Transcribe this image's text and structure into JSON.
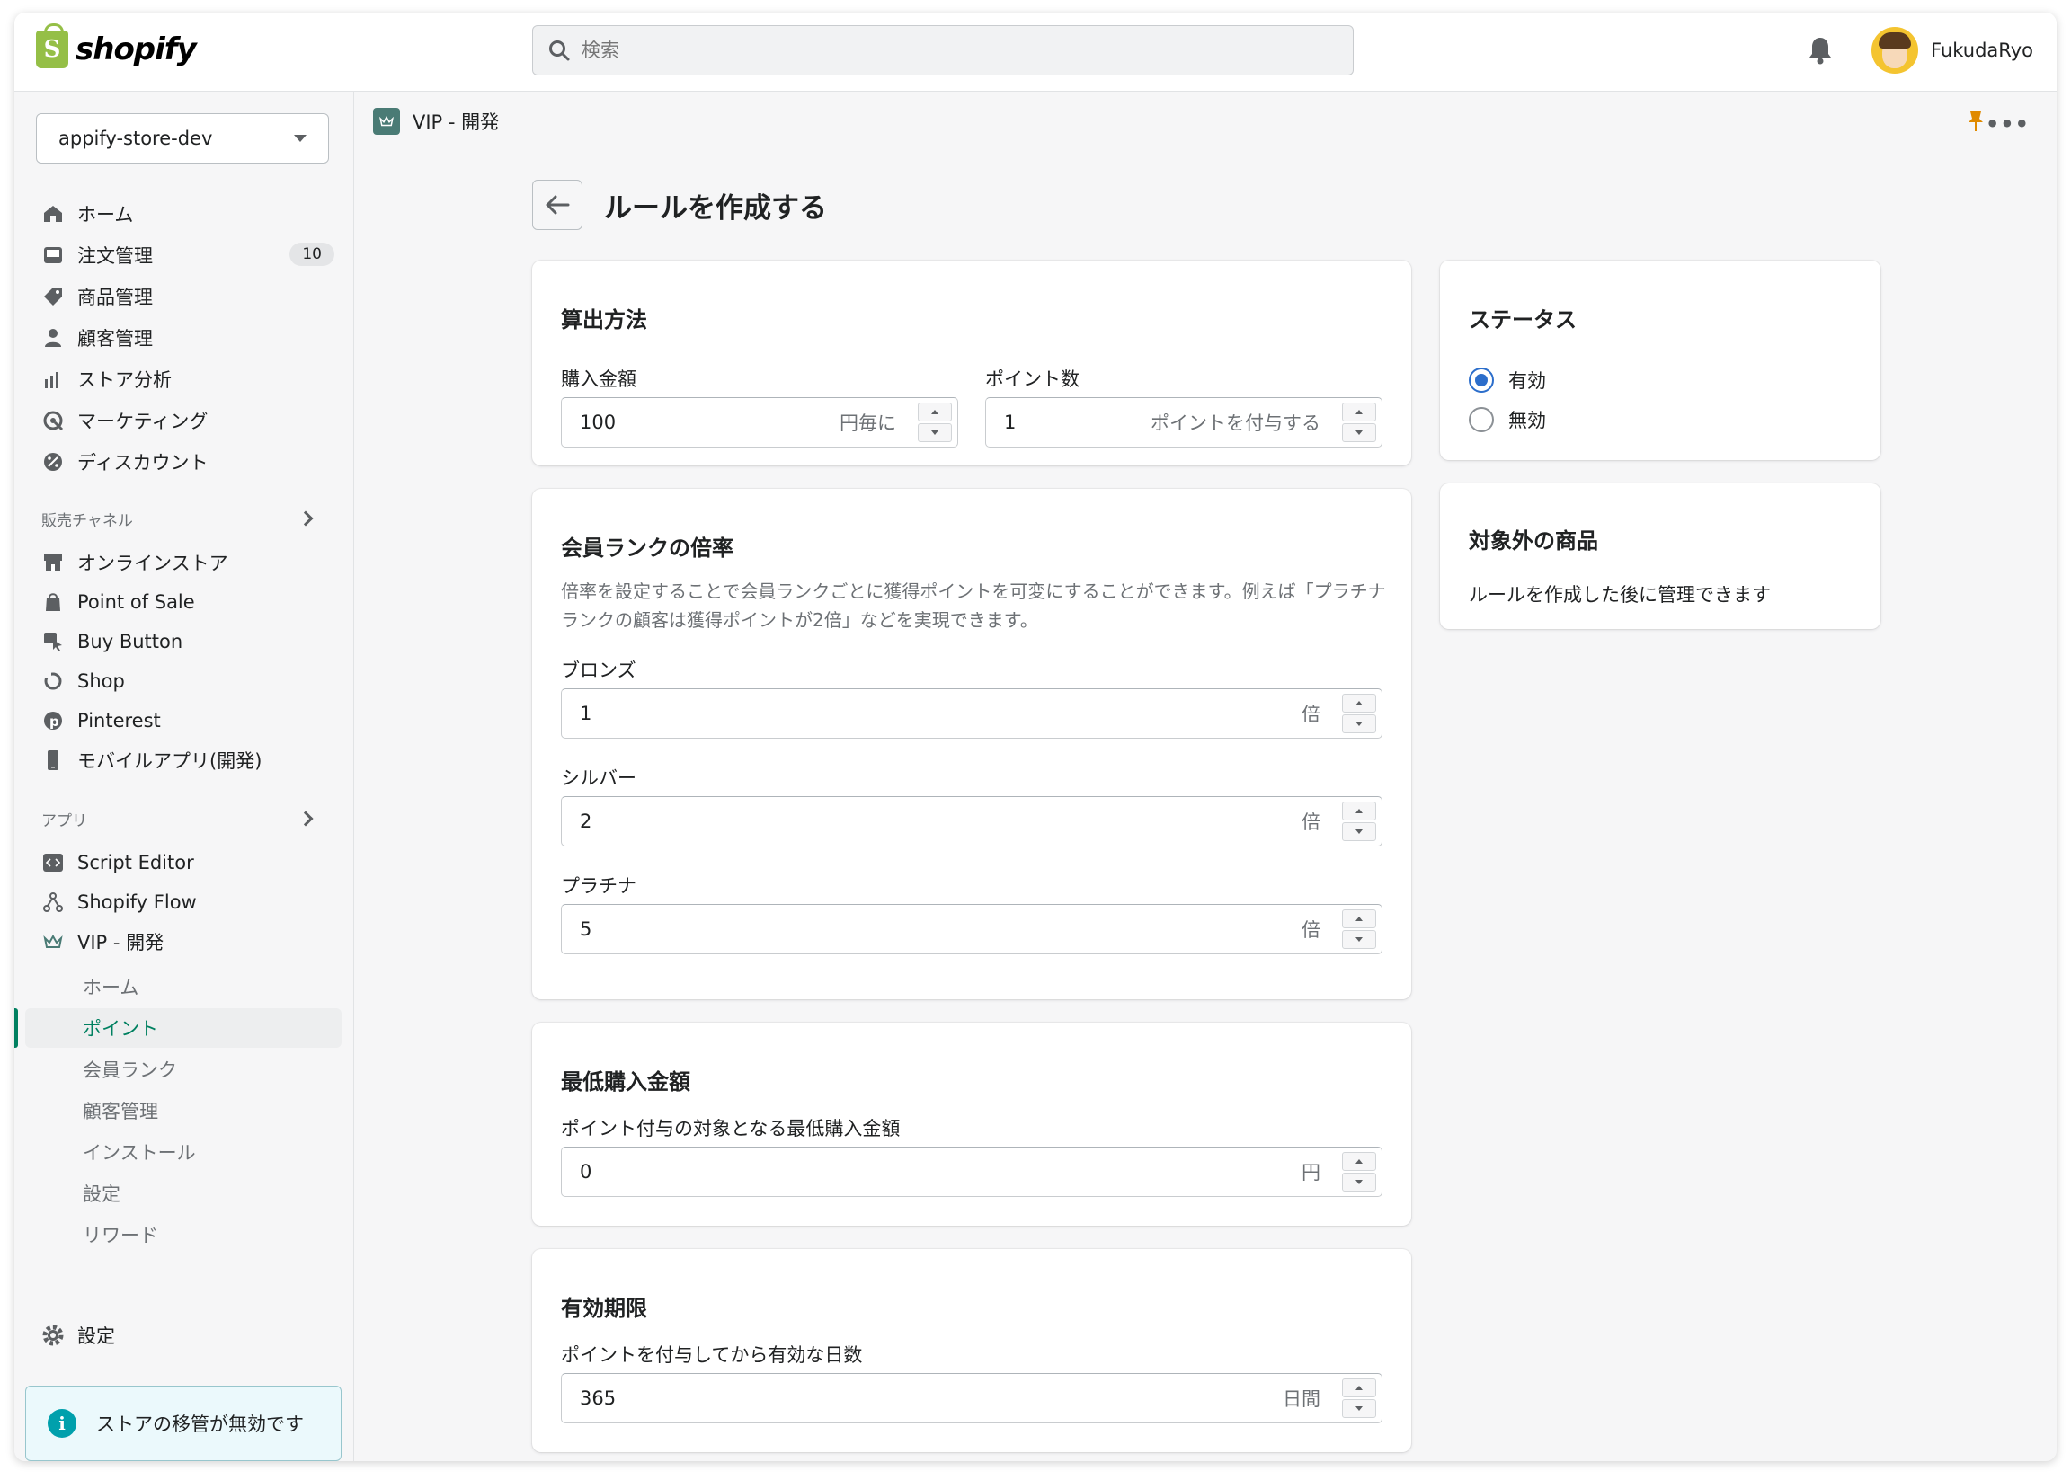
{
  "brand": {
    "name": "shopify",
    "color": "#95bf47",
    "logo_letter": "S"
  },
  "topbar": {
    "search_placeholder": "検索",
    "user_name": "FukudaRyo"
  },
  "sidebar": {
    "store": "appify-store-dev",
    "main_items": [
      {
        "label": "ホーム",
        "icon": "home-icon"
      },
      {
        "label": "注文管理",
        "icon": "inbox-icon",
        "badge": "10"
      },
      {
        "label": "商品管理",
        "icon": "tag-icon"
      },
      {
        "label": "顧客管理",
        "icon": "person-icon"
      },
      {
        "label": "ストア分析",
        "icon": "bar-chart-icon"
      },
      {
        "label": "マーケティング",
        "icon": "target-icon"
      },
      {
        "label": "ディスカウント",
        "icon": "discount-icon"
      }
    ],
    "sales_channels_title": "販売チャネル",
    "sales_channels": [
      {
        "label": "オンラインストア",
        "icon": "store-icon"
      },
      {
        "label": "Point of Sale",
        "icon": "pos-bag-icon"
      },
      {
        "label": "Buy Button",
        "icon": "buy-button-icon"
      },
      {
        "label": "Shop",
        "icon": "shop-icon"
      },
      {
        "label": "Pinterest",
        "icon": "pinterest-icon"
      },
      {
        "label": "モバイルアプリ(開発)",
        "icon": "mobile-icon"
      }
    ],
    "apps_title": "アプリ",
    "apps": [
      {
        "label": "Script Editor",
        "icon": "code-icon"
      },
      {
        "label": "Shopify Flow",
        "icon": "flow-icon"
      },
      {
        "label": "VIP - 開発",
        "icon": "crown-icon"
      }
    ],
    "vip_sub_items": [
      "ホーム",
      "ポイント",
      "会員ランク",
      "顧客管理",
      "インストール",
      "設定",
      "リワード"
    ],
    "active_sub_item": "ポイント",
    "settings_label": "設定",
    "notice": "ストアの移管が無効です"
  },
  "appbar": {
    "title": "VIP - 開発"
  },
  "page": {
    "title": "ルールを作成する",
    "calc": {
      "title": "算出方法",
      "amount_label": "購入金額",
      "amount_value": "100",
      "amount_suffix": "円毎に",
      "points_label": "ポイント数",
      "points_value": "1",
      "points_suffix": "ポイントを付与する"
    },
    "rank": {
      "title": "会員ランクの倍率",
      "description": "倍率を設定することで会員ランクごとに獲得ポイントを可変にすることができます。例えば「プラチナランクの顧客は獲得ポイントが2倍」などを実現できます。",
      "bronze_label": "ブロンズ",
      "bronze_value": "1",
      "silver_label": "シルバー",
      "silver_value": "2",
      "platinum_label": "プラチナ",
      "platinum_value": "5",
      "suffix": "倍"
    },
    "minimum": {
      "title": "最低購入金額",
      "label": "ポイント付与の対象となる最低購入金額",
      "value": "0",
      "suffix": "円"
    },
    "expiry": {
      "title": "有効期限",
      "label": "ポイントを付与してから有効な日数",
      "value": "365",
      "suffix": "日間"
    },
    "status": {
      "title": "ステータス",
      "options": [
        "有効",
        "無効"
      ],
      "selected": "有効"
    },
    "excluded": {
      "title": "対象外の商品",
      "text": "ルールを作成した後に管理できます"
    }
  },
  "colors": {
    "accent": "#008060",
    "radio": "#2c6ecb",
    "pin": "#e08a00",
    "notice_bg": "#ebf9fc"
  }
}
